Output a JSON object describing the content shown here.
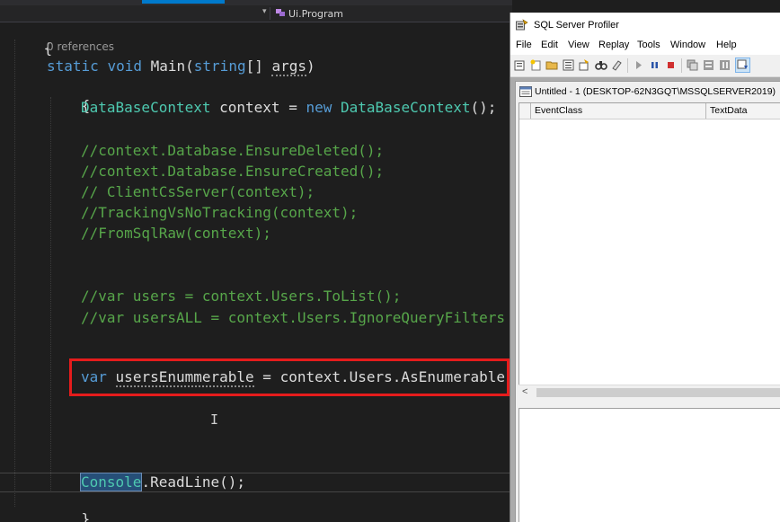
{
  "editor": {
    "nav_class_label": "Ui.Program",
    "codelens": "0 references",
    "lines": {
      "signature": {
        "mod": "static",
        "ret": "void",
        "name": "Main",
        "lp": "(",
        "ptype": "string",
        "arr": "[] ",
        "pname": "args",
        "rp": ")"
      },
      "open_brace_class": "{",
      "open_brace_method": "{",
      "ctx_decl": {
        "type": "DataBaseContext",
        "rest": " context = ",
        "kw_new": "new",
        "sp": " ",
        "type2": "DataBaseContext",
        "tail": "();"
      },
      "comments1": [
        "//context.Database.EnsureDeleted();",
        "//context.Database.EnsureCreated();",
        "// ClientCsServer(context);",
        "//TrackingVsNoTracking(context);",
        "//FromSqlRaw(context);"
      ],
      "comments2": [
        "//var users = context.Users.ToList();",
        "//var usersALL = context.Users.IgnoreQueryFilters"
      ],
      "enum_line": {
        "kw": "var",
        "sp": " ",
        "name": "usersEnummerable",
        "rest": " = context.Users.AsEnumerable"
      },
      "readline": {
        "console": "Console",
        "rest": ".ReadLine();"
      },
      "close_brace_method": "}"
    }
  },
  "profiler": {
    "title": "SQL Server Profiler",
    "menu": [
      "File",
      "Edit",
      "View",
      "Replay",
      "Tools",
      "Window",
      "Help"
    ],
    "trace_title": "Untitled - 1 (DESKTOP-62N3GQT\\MSSQLSERVER2019)",
    "columns": [
      "EventClass",
      "TextData"
    ],
    "scroll_left": "<"
  },
  "colors": {
    "editor_bg": "#1e1e1e",
    "keyword": "#569cd6",
    "type": "#4ec9b0",
    "comment": "#57a64a",
    "highlight_box": "#e51c1c"
  }
}
